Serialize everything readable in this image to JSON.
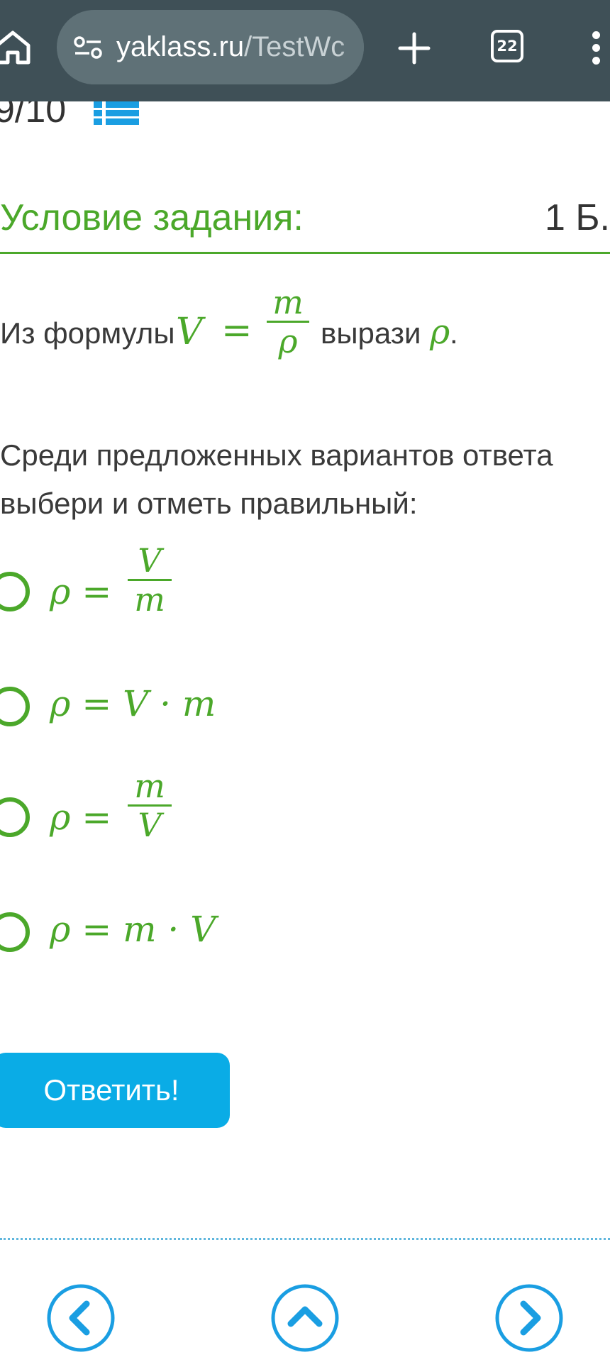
{
  "browser": {
    "url_host": "yaklass.ru",
    "url_path": "/TestWc",
    "tab_count": "22"
  },
  "test": {
    "progress": "9/10"
  },
  "task": {
    "title": "Условие задания:",
    "points": "1 Б.",
    "formula_prefix": "Из формулы",
    "formula_lhs": "V",
    "formula_eq": "=",
    "formula_num": "m",
    "formula_den": "ρ",
    "formula_suffix": "вырази",
    "target_var": "ρ",
    "period": ".",
    "instruction_line1": "Среди предложенных вариантов ответа",
    "instruction_line2": "выбери и отметь правильный:"
  },
  "options": [
    {
      "lhs": "ρ",
      "eq": "=",
      "num": "V",
      "den": "m"
    },
    {
      "lhs": "ρ",
      "eq": "=",
      "expr": "V · m"
    },
    {
      "lhs": "ρ",
      "eq": "=",
      "num": "m",
      "den": "V"
    },
    {
      "lhs": "ρ",
      "eq": "=",
      "expr": "m · V"
    }
  ],
  "actions": {
    "submit_label": "Ответить!"
  },
  "colors": {
    "accent_green": "#4ba82a",
    "accent_blue": "#0aace6",
    "toolbar": "#3f5057"
  },
  "icons": [
    "home-icon",
    "site-settings-icon",
    "new-tab-icon",
    "tab-switcher-icon",
    "more-menu-icon",
    "list-icon",
    "chevron-left-icon",
    "chevron-up-icon",
    "chevron-right-icon"
  ]
}
